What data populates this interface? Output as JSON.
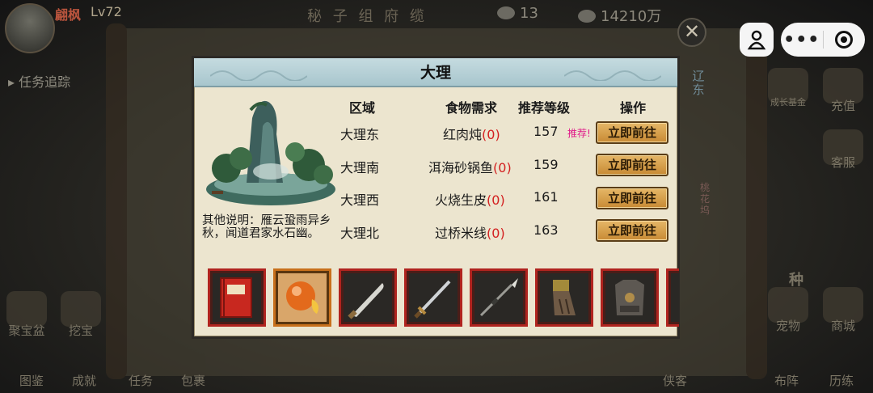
{
  "hud": {
    "player_name": "翩枫",
    "player_level": "Lv72",
    "title_dim": "秘 子 组 府 缆",
    "resource_1": "13",
    "resource_2": "14210万",
    "quest_track": "任务追踪"
  },
  "side_right": {
    "fund": "成长基金",
    "recharge": "充值",
    "service": "客服",
    "pet": "宠物",
    "shop": "商城",
    "formation": "布阵",
    "training": "历练",
    "hero": "侠客",
    "event": "种",
    "map_liaodong": "辽东",
    "map_taohuawu": "桃花坞"
  },
  "side_left": {
    "treasure_bowl": "聚宝盆",
    "dig": "挖宝",
    "atlas": "图鉴",
    "achievement": "成就",
    "task": "任务",
    "bag": "包裹"
  },
  "dialog": {
    "title": "大理",
    "headers": {
      "region": "区域",
      "food": "食物需求",
      "level": "推荐等级",
      "action": "操作"
    },
    "rows": [
      {
        "region": "大理东",
        "food": "红肉炖",
        "count": "(0)",
        "level": "157",
        "tag": "推荐!",
        "action": "立即前往"
      },
      {
        "region": "大理南",
        "food": "洱海砂锅鱼",
        "count": "(0)",
        "level": "159",
        "tag": "",
        "action": "立即前往"
      },
      {
        "region": "大理西",
        "food": "火烧生皮",
        "count": "(0)",
        "level": "161",
        "tag": "",
        "action": "立即前往"
      },
      {
        "region": "大理北",
        "food": "过桥米线",
        "count": "(0)",
        "level": "163",
        "tag": "",
        "action": "立即前往"
      }
    ],
    "description": "其他说明：雁云蛩雨异乡秋，闻道君家水石幽。",
    "items": [
      {
        "icon": "red-book-icon",
        "rarity": "red"
      },
      {
        "icon": "orange-orb-icon",
        "rarity": "orange"
      },
      {
        "icon": "saber-icon",
        "rarity": "red"
      },
      {
        "icon": "sword-icon",
        "rarity": "red"
      },
      {
        "icon": "spear-icon",
        "rarity": "red"
      },
      {
        "icon": "gauntlet-icon",
        "rarity": "red"
      },
      {
        "icon": "armor-icon",
        "rarity": "red"
      },
      {
        "icon": "partial-item-icon",
        "rarity": "red"
      }
    ]
  },
  "capsule": {
    "more": "•••"
  },
  "colors": {
    "accent_red": "#d31f1f",
    "recommend_pink": "#e01989",
    "button_gold": "#d9a24d",
    "header_blue": "#b3cfd5"
  }
}
